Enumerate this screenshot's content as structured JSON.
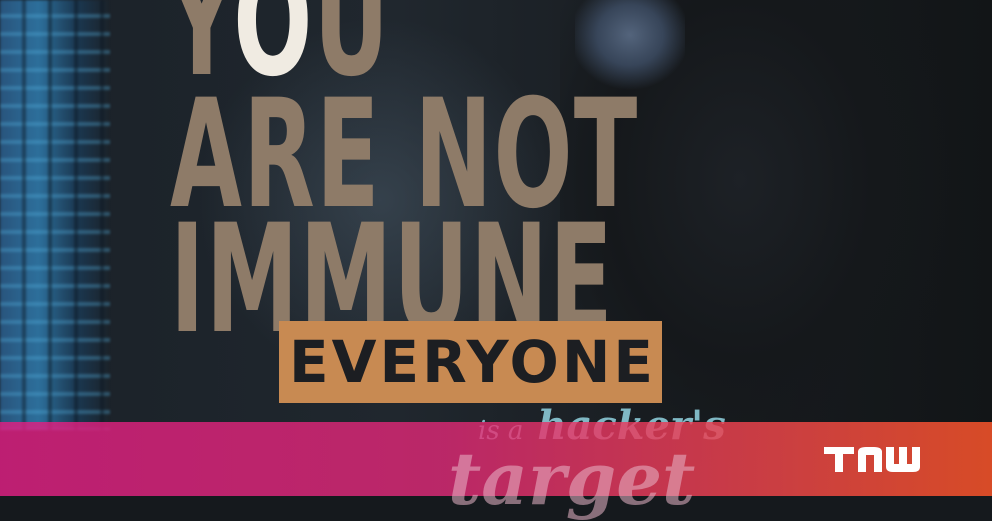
{
  "headline": {
    "line1_start": "Y",
    "line1_o": "O",
    "line1_end": "U",
    "line2": "ARE NOT",
    "line3": "IMMUNE"
  },
  "badge": {
    "text": "EVERYONE"
  },
  "tagline": {
    "prefix": "is a",
    "word1": "hacker's",
    "word2": "target"
  },
  "brand": {
    "logo_text": "TNW",
    "bar_gradient": [
      "#e11e82",
      "#e8502a"
    ],
    "logo_color": "#ffffff"
  },
  "colors": {
    "headline": "#8e7b68",
    "badge_bg": "#c88a52",
    "badge_text": "#1c1e22",
    "accent_o": "#f0ebe2"
  }
}
